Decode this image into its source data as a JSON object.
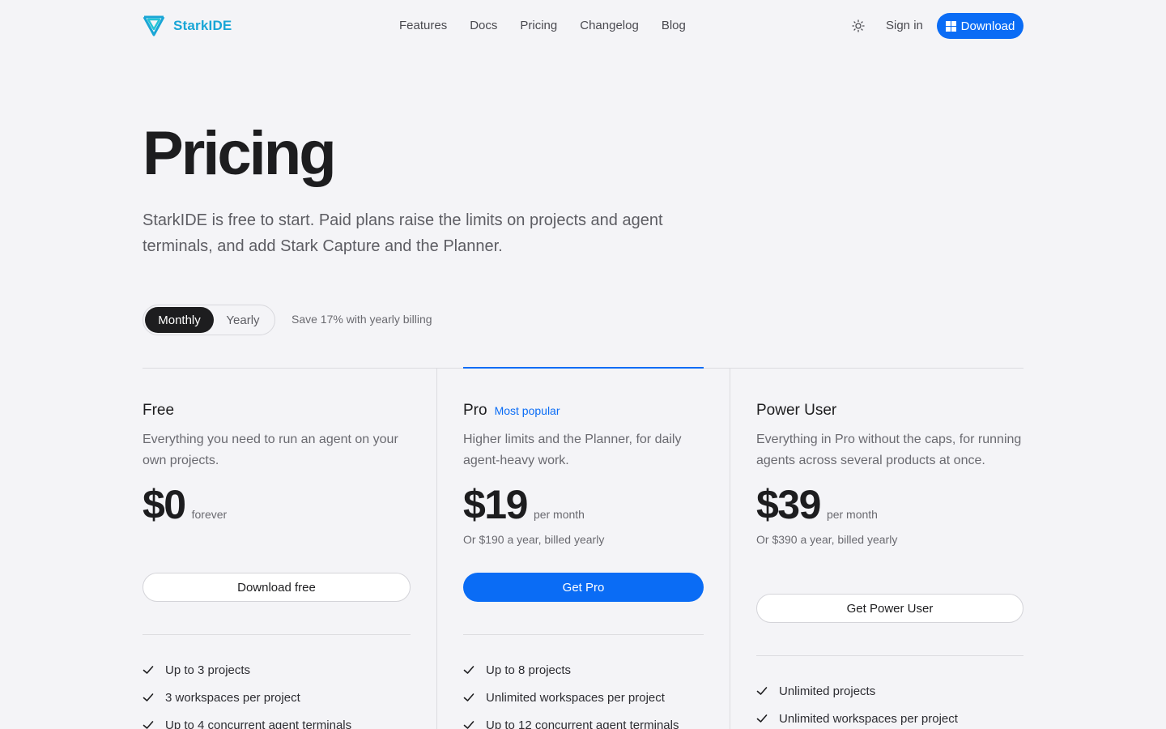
{
  "brand": {
    "name": "StarkIDE",
    "color": "#1aa6d6"
  },
  "nav": {
    "links": [
      "Features",
      "Docs",
      "Pricing",
      "Changelog",
      "Blog"
    ],
    "theme_icon": "sun-icon",
    "signin": "Sign in",
    "download": "Download"
  },
  "hero": {
    "title": "Pricing",
    "subtitle": "StarkIDE is free to start. Paid plans raise the limits on projects and agent terminals, and add Stark Capture and the Planner."
  },
  "billing": {
    "options": [
      "Monthly",
      "Yearly"
    ],
    "selected": "Monthly",
    "save_note": "Save 17% with yearly billing"
  },
  "colors": {
    "accent": "#0a6cf5",
    "text": "#1d1d1f",
    "muted": "#6a6a70",
    "background": "#f4f4f7"
  },
  "plans": [
    {
      "name": "Free",
      "badge": "",
      "description": "Everything you need to run an agent on your own projects.",
      "price": "$0",
      "period": "forever",
      "yearly": "",
      "cta": "Download free",
      "features": [
        "Up to 3 projects",
        "3 workspaces per project",
        "Up to 4 concurrent agent terminals"
      ]
    },
    {
      "name": "Pro",
      "badge": "Most popular",
      "description": "Higher limits and the Planner, for daily agent-heavy work.",
      "price": "$19",
      "period": "per month",
      "yearly": "Or $190 a year, billed yearly",
      "cta": "Get Pro",
      "features": [
        "Up to 8 projects",
        "Unlimited workspaces per project",
        "Up to 12 concurrent agent terminals"
      ]
    },
    {
      "name": "Power User",
      "badge": "",
      "description": "Everything in Pro without the caps, for running agents across several products at once.",
      "price": "$39",
      "period": "per month",
      "yearly": "Or $390 a year, billed yearly",
      "cta": "Get Power User",
      "features": [
        "Unlimited projects",
        "Unlimited workspaces per project"
      ]
    }
  ]
}
